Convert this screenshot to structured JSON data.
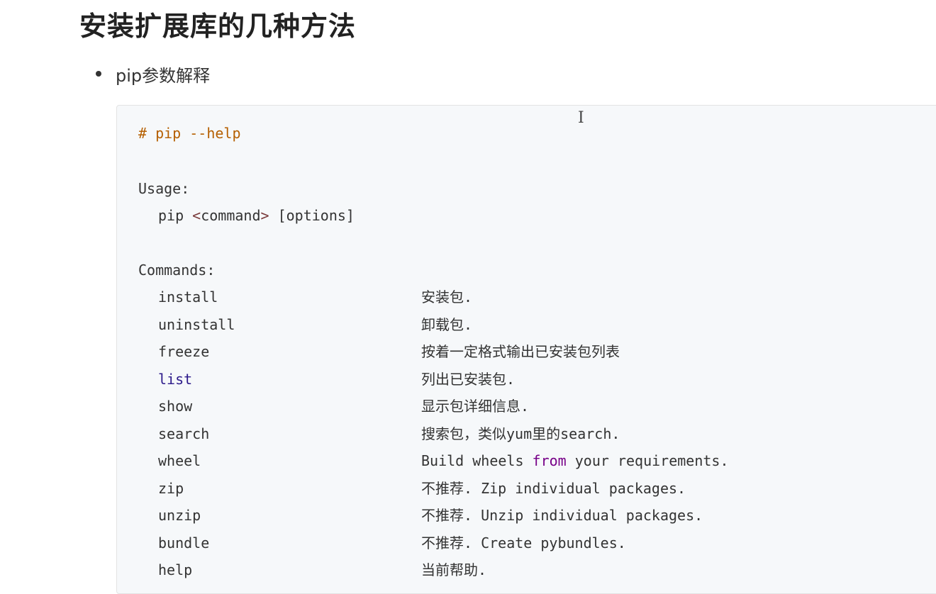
{
  "heading": "安装扩展库的几种方法",
  "bullet": "pip参数解释",
  "code": {
    "prompt_line": "# pip --help",
    "usage_label": "Usage:",
    "usage_pip": "pip ",
    "usage_lt": "<",
    "usage_command": "command",
    "usage_gt": ">",
    "usage_options": " [options]",
    "commands_label": "Commands:",
    "commands": [
      {
        "name": "install",
        "desc": "安装包."
      },
      {
        "name": "uninstall",
        "desc": "卸载包."
      },
      {
        "name": "freeze",
        "desc": "按着一定格式输出已安装包列表"
      },
      {
        "name": "list",
        "desc": "列出已安装包."
      },
      {
        "name": "show",
        "desc": "显示包详细信息."
      },
      {
        "name": "search",
        "desc": "搜索包，类似yum里的search."
      },
      {
        "name": "wheel",
        "desc_a": "Build wheels ",
        "desc_kw": "from",
        "desc_b": " your requirements."
      },
      {
        "name": "zip",
        "desc": "不推荐. Zip individual packages."
      },
      {
        "name": "unzip",
        "desc": "不推荐. Unzip individual packages."
      },
      {
        "name": "bundle",
        "desc": "不推荐. Create pybundles."
      },
      {
        "name": "help",
        "desc": "当前帮助."
      }
    ]
  },
  "colors": {
    "comment": "#b55f00",
    "keyword": "#2c1a8a",
    "from_keyword": "#770088",
    "code_background": "#f6f8fa"
  },
  "cursor_icon": "text-cursor-icon"
}
